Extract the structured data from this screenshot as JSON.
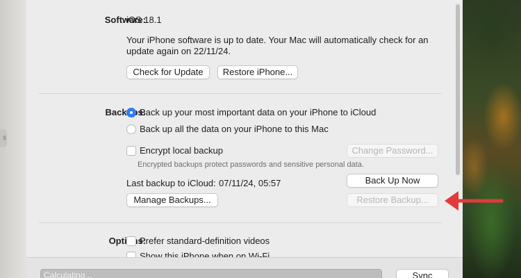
{
  "software": {
    "label": "Software:",
    "version": "iOS 18.1",
    "status_line1": "Your iPhone software is up to date. Your Mac will automatically check for an",
    "status_line2": "update again on 22/11/24.",
    "check_button": "Check for Update",
    "restore_button": "Restore iPhone..."
  },
  "backups": {
    "label": "Backups:",
    "option_icloud": "Back up your most important data on your iPhone to iCloud",
    "option_mac": "Back up all the data on your iPhone to this Mac",
    "selected_option": "icloud",
    "encrypt_label": "Encrypt local backup",
    "encrypt_checked": false,
    "change_password_button": "Change Password...",
    "encrypt_note": "Encrypted backups protect passwords and sensitive personal data.",
    "last_backup_label": "Last backup to iCloud:",
    "last_backup_value": "07/11/24, 05:57",
    "back_up_now_button": "Back Up Now",
    "manage_button": "Manage Backups...",
    "restore_backup_button": "Restore Backup..."
  },
  "options": {
    "label": "Options:",
    "prefer_sd": "Prefer standard-definition videos",
    "show_wifi": "Show this iPhone when on Wi-Fi"
  },
  "footer": {
    "progress_text": "Calculating...",
    "sync_button": "Sync"
  },
  "left_handle_glyph": "s",
  "colors": {
    "accent": "#2f7cf6",
    "arrow": "#e23a3a"
  }
}
